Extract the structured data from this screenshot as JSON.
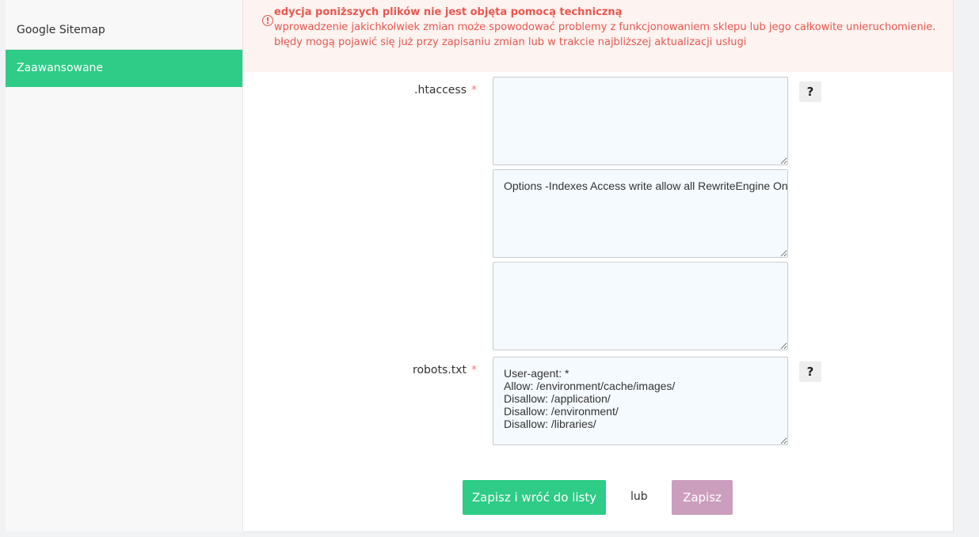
{
  "sidebar": {
    "items": [
      {
        "label": "Google Sitemap",
        "active": false
      },
      {
        "label": "Zaawansowane",
        "active": true
      }
    ]
  },
  "alert": {
    "icon": "exclamation-circle-icon",
    "title": "edycja poniższych plików nie jest objęta pomocą techniczną",
    "line1": "wprowadzenie jakichkolwiek zmian może spowodować problemy z funkcjonowaniem sklepu lub jego całkowite unieruchomienie.",
    "line2": "błędy mogą pojawić się już przy zapisaniu zmian lub w trakcie najbliższej aktualizacji usługi"
  },
  "fields": {
    "htaccess": {
      "label": ".htaccess",
      "required": "*",
      "textarea1": "",
      "textarea2": "Options -Indexes Access write allow all RewriteEngine On",
      "textarea3": "",
      "help": "?"
    },
    "robots": {
      "label": "robots.txt",
      "required": "*",
      "value": "User-agent: *\nAllow: /environment/cache/images/\nDisallow: /application/\nDisallow: /environment/\nDisallow: /libraries/",
      "help": "?"
    }
  },
  "actions": {
    "save_back": "Zapisz i wróć do listy",
    "or": "lub",
    "save": "Zapisz"
  },
  "colors": {
    "accent": "#2ecc87",
    "alert_text": "#e8584f",
    "alert_bg": "#fdf3f0",
    "save_button": "#cc9ebe"
  }
}
